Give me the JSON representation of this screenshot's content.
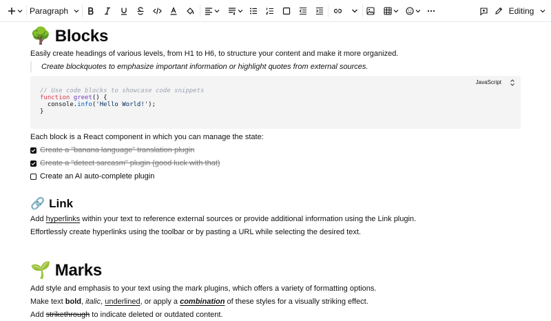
{
  "toolbar": {
    "block_type": "Paragraph",
    "mode_label": "Editing",
    "icons": [
      "plus-icon",
      "chevron-down-icon",
      "bold-icon",
      "italic-icon",
      "underline-icon",
      "strikethrough-icon",
      "code-icon",
      "font-color-icon",
      "highlight-icon",
      "align-icon",
      "line-height-icon",
      "bulleted-list-icon",
      "numbered-list-icon",
      "checkbox-list-icon",
      "outdent-icon",
      "indent-icon",
      "link-icon",
      "image-icon",
      "table-icon",
      "emoji-icon",
      "more-icon",
      "comment-icon",
      "pencil-icon"
    ]
  },
  "blocks": {
    "emoji": "🌳",
    "title": "Blocks",
    "intro": "Easily create headings of various levels, from H1 to H6, to structure your content and make it more organized.",
    "quote": "Create blockquotes to emphasize important information or highlight quotes from external sources.",
    "code": {
      "language": "JavaScript",
      "comment": "// Use code blocks to showcase code snippets",
      "kw": "function",
      "fn": "greet",
      "sig": "() {",
      "l3_a": "  console.",
      "l3_prop": "info",
      "l3_b": "(",
      "l3_str": "'Hello World!'",
      "l3_c": ");",
      "l4": "}"
    },
    "react_text": "Each block is a React component in which you can manage the state:",
    "todos": [
      {
        "label": "Create a \"banana language\" translation plugin",
        "checked": true
      },
      {
        "label": "Create a \"detect sarcasm\" plugin (good luck with that)",
        "checked": true
      },
      {
        "label": "Create an AI auto-complete plugin",
        "checked": false
      }
    ]
  },
  "link_section": {
    "emoji": "🔗",
    "title": "Link",
    "p1_a": "Add ",
    "p1_link": "hyperlinks",
    "p1_b": " within your text to reference external sources or provide additional information using the Link plugin.",
    "p2": "Effortlessly create hyperlinks using the toolbar or by pasting a URL while selecting the desired text."
  },
  "marks": {
    "emoji": "🌱",
    "title": "Marks",
    "p1": "Add style and emphasis to your text using the mark plugins, which offers a variety of formatting options.",
    "p2_a": "Make text ",
    "p2_bold": "bold",
    "p2_c1": ", ",
    "p2_italic": "italic",
    "p2_c2": ", ",
    "p2_under": "underlined",
    "p2_c3": ", or apply a ",
    "p2_combo": "combination",
    "p2_end": " of these styles for a visually striking effect.",
    "p3_a": "Add ",
    "p3_strike": "strikethrough",
    "p3_b": " to indicate deleted or outdated content."
  }
}
